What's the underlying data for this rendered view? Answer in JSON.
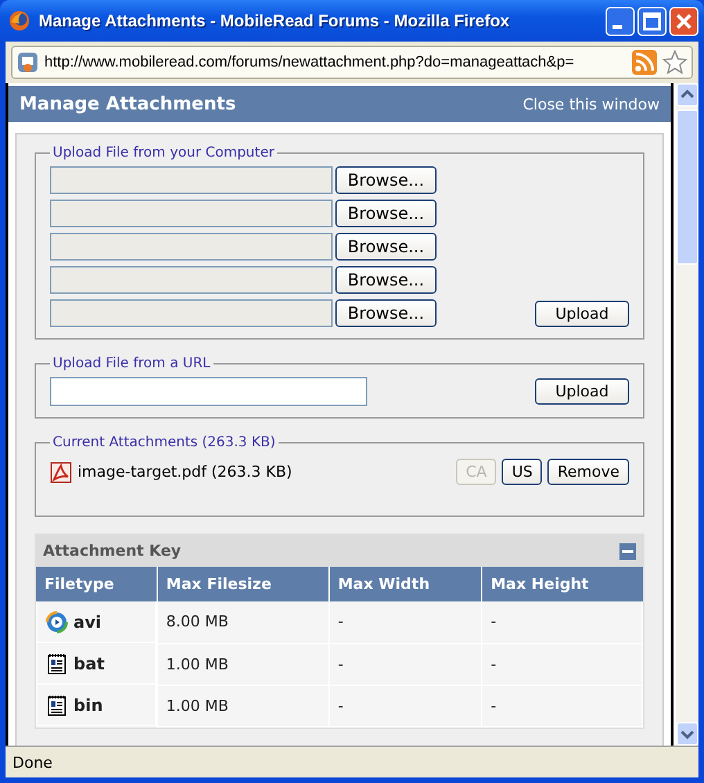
{
  "window": {
    "title": "Manage Attachments - MobileRead Forums - Mozilla Firefox"
  },
  "address_bar": {
    "url": "http://www.mobileread.com/forums/newattachment.php?do=manageattach&p="
  },
  "header": {
    "title": "Manage Attachments",
    "close_link": "Close this window"
  },
  "upload_computer": {
    "legend": "Upload File from your Computer",
    "browse_buttons": [
      "Browse...",
      "Browse...",
      "Browse...",
      "Browse...",
      "Browse..."
    ],
    "upload_button": "Upload"
  },
  "upload_url": {
    "legend": "Upload File from a URL",
    "upload_button": "Upload"
  },
  "current_attachments": {
    "legend": "Current Attachments (263.3 KB)",
    "files": [
      {
        "name": "image-target.pdf (263.3 KB)",
        "buttons": [
          {
            "label": "CA",
            "disabled": true
          },
          {
            "label": "US",
            "disabled": false
          },
          {
            "label": "Remove",
            "disabled": false
          }
        ]
      }
    ]
  },
  "attachment_key": {
    "title": "Attachment Key",
    "expanded": true,
    "columns": [
      "Filetype",
      "Max Filesize",
      "Max Width",
      "Max Height"
    ],
    "rows": [
      {
        "kind": "video",
        "cells": [
          "avi",
          "8.00 MB",
          "-",
          "-"
        ]
      },
      {
        "kind": "document",
        "cells": [
          "bat",
          "1.00 MB",
          "-",
          "-"
        ]
      },
      {
        "kind": "document",
        "cells": [
          "bin",
          "1.00 MB",
          "-",
          "-"
        ]
      }
    ]
  },
  "status_bar": {
    "text": "Done"
  }
}
